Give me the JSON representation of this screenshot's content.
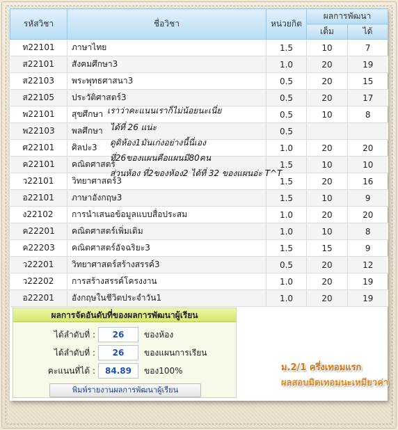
{
  "table": {
    "headers": {
      "code": "รหัสวิชา",
      "name": "ชื่อวิชา",
      "credit": "หน่วยกิต",
      "group": "ผลการพัฒนา",
      "full": "เต็ม",
      "got": "ได้"
    },
    "rows": [
      {
        "code": "ท22101",
        "name": "ภาษาไทย",
        "credit": "1.5",
        "full": "10",
        "got": "7"
      },
      {
        "code": "ส22101",
        "name": "สังคมศึกษา3",
        "credit": "1.0",
        "full": "20",
        "got": "19"
      },
      {
        "code": "ส22103",
        "name": "พระพุทธศาสนา3",
        "credit": "0.5",
        "full": "20",
        "got": "15"
      },
      {
        "code": "ส22105",
        "name": "ประวัติศาสตร์3",
        "credit": "0.5",
        "full": "20",
        "got": "17"
      },
      {
        "code": "พ22101",
        "name": "สุขศึกษา",
        "credit": "0.5",
        "full": "10",
        "got": "8"
      },
      {
        "code": "พ22103",
        "name": "พลศึกษา",
        "credit": "0.5",
        "full": "",
        "got": ""
      },
      {
        "code": "ศ22101",
        "name": "ศิลปะ3",
        "credit": "1.0",
        "full": "20",
        "got": "20"
      },
      {
        "code": "ค22101",
        "name": "คณิตศาสตร์",
        "credit": "1.5",
        "full": "10",
        "got": "10"
      },
      {
        "code": "ว22101",
        "name": "วิทยาศาสตร์3",
        "credit": "1.5",
        "full": "20",
        "got": "16"
      },
      {
        "code": "อ22101",
        "name": "ภาษาอังกฤษ3",
        "credit": "1.5",
        "full": "10",
        "got": "9"
      },
      {
        "code": "ง22102",
        "name": "การนำเสนอข้อมูลแบบสื่อประสม",
        "credit": "1.0",
        "full": "20",
        "got": "20"
      },
      {
        "code": "ค22201",
        "name": "คณิตศาสตร์เพิ่มเติม",
        "credit": "1.0",
        "full": "10",
        "got": "8"
      },
      {
        "code": "ค22203",
        "name": "คณิตศาสตร์อัจฉริยะ3",
        "credit": "1.5",
        "full": "15",
        "got": "9"
      },
      {
        "code": "ว22201",
        "name": "วิทยาศาสตร์สร้างสรรค์3",
        "credit": "0.5",
        "full": "20",
        "got": "12"
      },
      {
        "code": "ว22202",
        "name": "การสร้างสรรค์โครงงาน",
        "credit": "1.0",
        "full": "20",
        "got": "19"
      },
      {
        "code": "อ22201",
        "name": "อังกฤษในชีวิตประจำวัน1",
        "credit": "1.0",
        "full": "20",
        "got": "19"
      }
    ]
  },
  "handwritten_note": [
    "เราว่าคะแนนเราก็ไม่น้อยนะเนี่ย",
    "ได้ที่ 26 แน่ะ",
    "ดูดิห้อง1มันเก่งอย่างนี้นี่เอง",
    "ที่26ของแผนคือแผนมี80คน",
    "ส่วนห้อง ที่2ของห้อง2 ได้ที่ 32 ของแผนอ่ะ T^T"
  ],
  "ranking": {
    "title": "ผลการจัดอันดับที่ของผลการพัฒนาผู้เรียน",
    "class_rank_label": "ได้ลำดับที่ :",
    "class_rank": "26",
    "class_rank_unit": "ของห้อง",
    "plan_rank_label": "ได้ลำดับที่ :",
    "plan_rank": "26",
    "plan_rank_unit": "ของแผนการเรียน",
    "score_label": "คะแนนที่ได้ :",
    "score": "84.89",
    "score_unit": "ของ100%",
    "print_button": "พิมพ์รายงานผลการพัฒนาผู้เรียน"
  },
  "caption": {
    "line1": "ม.2/1 ครึ่งเทอมแรก",
    "line2": "ผลสอบมิดเทอมนะเหมียวค่า"
  },
  "colors": {
    "header_bg": "#c7e4f6",
    "rank_title_bg": "#dcec7a",
    "rank_value_text": "#1f4fb0",
    "caption_orange": "#d07a14"
  }
}
